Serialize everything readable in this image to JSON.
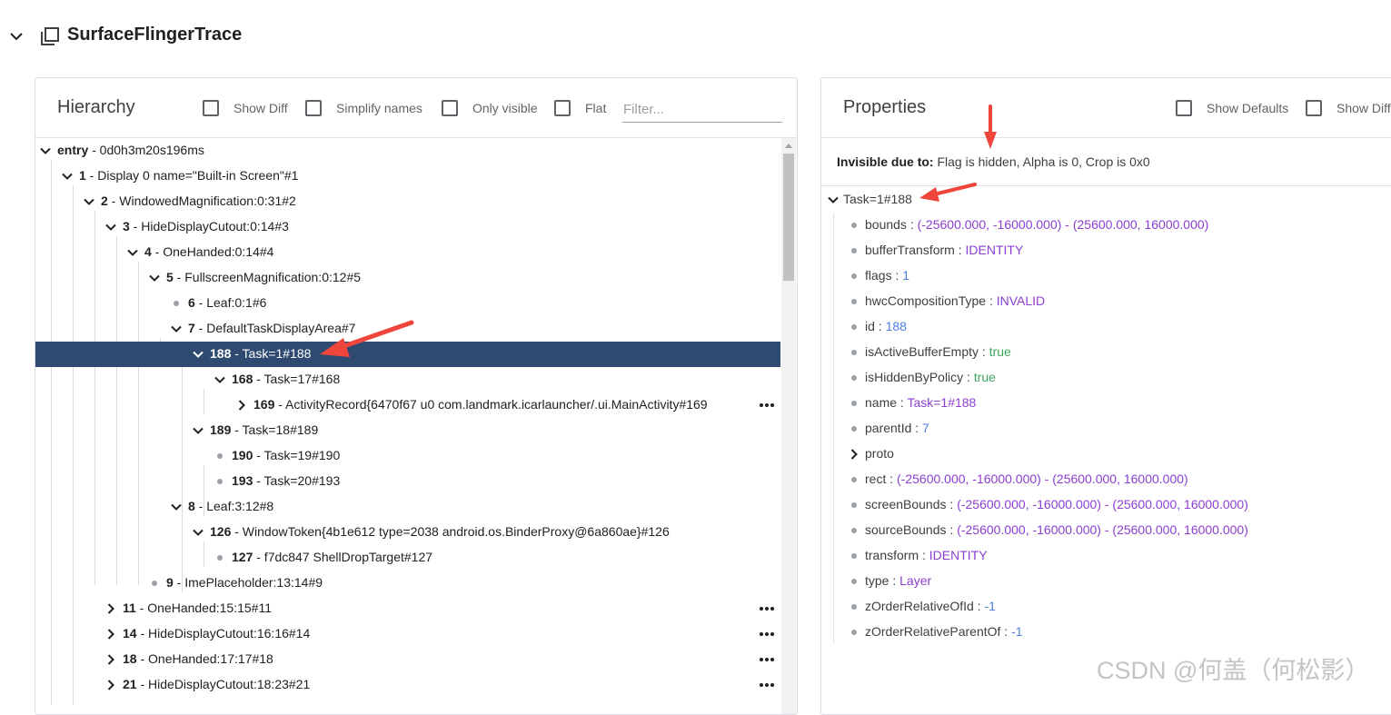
{
  "header": {
    "title": "SurfaceFlingerTrace",
    "collapse_icon": "chevron-down-icon",
    "trace_icon": "copy-layers-icon"
  },
  "hierarchy": {
    "title": "Hierarchy",
    "options": [
      "Show Diff",
      "Simplify names",
      "Only visible",
      "Flat"
    ],
    "filter_placeholder": "Filter...",
    "rows": [
      {
        "id": "entry",
        "name": " - 0d0h3m20s196ms",
        "kind": "expanded"
      },
      {
        "id": "1",
        "name": " - Display 0 name=\"Built-in Screen\"#1",
        "kind": "expanded"
      },
      {
        "id": "2",
        "name": " - WindowedMagnification:0:31#2",
        "kind": "expanded"
      },
      {
        "id": "3",
        "name": " - HideDisplayCutout:0:14#3",
        "kind": "expanded"
      },
      {
        "id": "4",
        "name": " - OneHanded:0:14#4",
        "kind": "expanded"
      },
      {
        "id": "5",
        "name": " - FullscreenMagnification:0:12#5",
        "kind": "expanded"
      },
      {
        "id": "6",
        "name": " - Leaf:0:1#6",
        "kind": "leaf"
      },
      {
        "id": "7",
        "name": " - DefaultTaskDisplayArea#7",
        "kind": "expanded"
      },
      {
        "id": "188",
        "name": " - Task=1#188",
        "kind": "expanded",
        "selected": true
      },
      {
        "id": "168",
        "name": " - Task=17#168",
        "kind": "expanded"
      },
      {
        "id": "169",
        "name": " - ActivityRecord{6470f67 u0 com.landmark.icarlauncher/.ui.MainActivity#169",
        "kind": "collapsed",
        "more": true
      },
      {
        "id": "189",
        "name": " - Task=18#189",
        "kind": "expanded"
      },
      {
        "id": "190",
        "name": " - Task=19#190",
        "kind": "leaf"
      },
      {
        "id": "193",
        "name": " - Task=20#193",
        "kind": "leaf"
      },
      {
        "id": "8",
        "name": " - Leaf:3:12#8",
        "kind": "expanded"
      },
      {
        "id": "126",
        "name": " - WindowToken{4b1e612 type=2038 android.os.BinderProxy@6a860ae}#126",
        "kind": "expanded"
      },
      {
        "id": "127",
        "name": " - f7dc847 ShellDropTarget#127",
        "kind": "leaf"
      },
      {
        "id": "9",
        "name": " - ImePlaceholder:13:14#9",
        "kind": "leaf"
      },
      {
        "id": "11",
        "name": " - OneHanded:15:15#11",
        "kind": "collapsed",
        "more": true
      },
      {
        "id": "14",
        "name": " - HideDisplayCutout:16:16#14",
        "kind": "collapsed",
        "more": true
      },
      {
        "id": "18",
        "name": " - OneHanded:17:17#18",
        "kind": "collapsed",
        "more": true
      },
      {
        "id": "21",
        "name": " - HideDisplayCutout:18:23#21",
        "kind": "collapsed",
        "more": true
      }
    ]
  },
  "properties": {
    "title": "Properties",
    "options": [
      "Show Defaults",
      "Show Diff"
    ],
    "invisible_label": "Invisible due to:",
    "invisible_value": " Flag is hidden, Alpha is 0, Crop is 0x0",
    "root": "Task=1#188",
    "items": [
      {
        "key": "bounds",
        "value": "(-25600.000, -16000.000) - (25600.000, 16000.000)",
        "tone": "purple"
      },
      {
        "key": "bufferTransform",
        "value": "IDENTITY",
        "tone": "purple"
      },
      {
        "key": "flags",
        "value": "1",
        "tone": "blue"
      },
      {
        "key": "hwcCompositionType",
        "value": "INVALID",
        "tone": "purple"
      },
      {
        "key": "id",
        "value": "188",
        "tone": "blue"
      },
      {
        "key": "isActiveBufferEmpty",
        "value": "true",
        "tone": "green"
      },
      {
        "key": "isHiddenByPolicy",
        "value": "true",
        "tone": "green"
      },
      {
        "key": "name",
        "value": "Task=1#188",
        "tone": "purple"
      },
      {
        "key": "parentId",
        "value": "7",
        "tone": "blue"
      },
      {
        "key": "proto",
        "value": "",
        "tone": "none",
        "collapsed": true
      },
      {
        "key": "rect",
        "value": "(-25600.000, -16000.000) - (25600.000, 16000.000)",
        "tone": "purple"
      },
      {
        "key": "screenBounds",
        "value": "(-25600.000, -16000.000) - (25600.000, 16000.000)",
        "tone": "purple"
      },
      {
        "key": "sourceBounds",
        "value": "(-25600.000, -16000.000) - (25600.000, 16000.000)",
        "tone": "purple"
      },
      {
        "key": "transform",
        "value": "IDENTITY",
        "tone": "purple"
      },
      {
        "key": "type",
        "value": "Layer",
        "tone": "purple"
      },
      {
        "key": "zOrderRelativeOfId",
        "value": "-1",
        "tone": "blue"
      },
      {
        "key": "zOrderRelativeParentOf",
        "value": "-1",
        "tone": "blue"
      }
    ]
  },
  "colors": {
    "selected_row": "#2f4a70",
    "annotation_arrow": "#f0453a",
    "value_purple": "#8a3fd1",
    "value_blue": "#4f7de0",
    "value_green": "#3ea55d"
  },
  "watermark": "CSDN @何盖（何松影）"
}
